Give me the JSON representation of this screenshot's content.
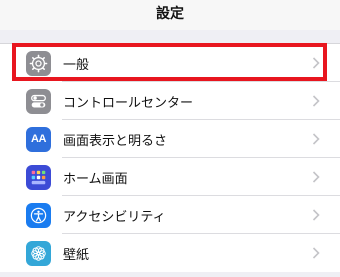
{
  "nav": {
    "title": "設定"
  },
  "items": [
    {
      "label": "一般",
      "icon": "gear-icon",
      "color": "#8e8e93"
    },
    {
      "label": "コントロールセンター",
      "icon": "toggles-icon",
      "color": "#8e8e93"
    },
    {
      "label": "画面表示と明るさ",
      "icon": "text-size-icon",
      "color": "#2f6fdc"
    },
    {
      "label": "ホーム画面",
      "icon": "home-grid-icon",
      "color": "#3c4bd6"
    },
    {
      "label": "アクセシビリティ",
      "icon": "accessibility-icon",
      "color": "#1a7cf0"
    },
    {
      "label": "壁紙",
      "icon": "wallpaper-icon",
      "color": "#33a7d8"
    }
  ],
  "highlight": {
    "color": "#e8161f",
    "target": "一般"
  },
  "icon_text": {
    "text_size": "AA"
  }
}
